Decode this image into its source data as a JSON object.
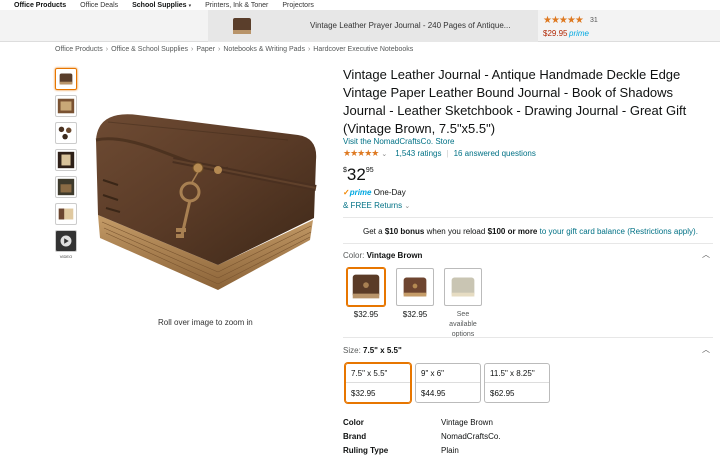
{
  "topnav": [
    "Office Products",
    "Office Deals",
    "School Supplies",
    "Printers, Ink & Toner",
    "Projectors"
  ],
  "sticky": {
    "title": "Vintage Leather Prayer Journal - 240 Pages of Antique...",
    "rating_count": "31",
    "price": "$29.95",
    "prime": "prime",
    "stars": "★★★★★"
  },
  "breadcrumb": [
    "Office Products",
    "Office & School Supplies",
    "Paper",
    "Notebooks & Writing Pads",
    "Hardcover Executive Notebooks"
  ],
  "gallery": {
    "video_label": "VIDEO",
    "zoom_text": "Roll over image to zoom in"
  },
  "product": {
    "title": "Vintage Leather Journal - Antique Handmade Deckle Edge Vintage Paper Leather Bound Journal - Book of Shadows Journal - Leather Sketchbook - Drawing Journal - Great Gift (Vintage Brown, 7.5\"x5.5\")",
    "store": "Visit the NomadCraftsCo. Store",
    "stars": "★★★★★",
    "ratings": "1,543 ratings",
    "answered": "16 answered questions",
    "price_symbol": "$",
    "price_dollars": "32",
    "price_cents": "95",
    "prime_label": "prime",
    "prime_delivery": "One-Day",
    "free_returns": "& FREE Returns",
    "promo_pre": "Get a",
    "promo_bonus": "$10 bonus",
    "promo_mid": "when you reload",
    "promo_amount": "$100 or more",
    "promo_post": "to your gift card balance (Restrictions apply)."
  },
  "color": {
    "label": "Color:",
    "selected": "Vintage Brown",
    "options": [
      {
        "price": "$32.95"
      },
      {
        "price": "$32.95"
      },
      {
        "note": "See available options"
      }
    ]
  },
  "size": {
    "label": "Size:",
    "selected": "7.5\" x 5.5\"",
    "options": [
      {
        "size": "7.5\" x 5.5\"",
        "price": "$32.95"
      },
      {
        "size": "9\" x 6\"",
        "price": "$44.95"
      },
      {
        "size": "11.5\" x 8.25\"",
        "price": "$62.95"
      }
    ]
  },
  "specs": [
    {
      "k": "Color",
      "v": "Vintage Brown"
    },
    {
      "k": "Brand",
      "v": "NomadCraftsCo."
    },
    {
      "k": "Ruling Type",
      "v": "Plain"
    }
  ],
  "colors": {
    "link": "#007185",
    "price_red": "#b12704",
    "star": "#de7921",
    "prime_blue": "#00a8e1",
    "selected_border": "#e77600"
  }
}
